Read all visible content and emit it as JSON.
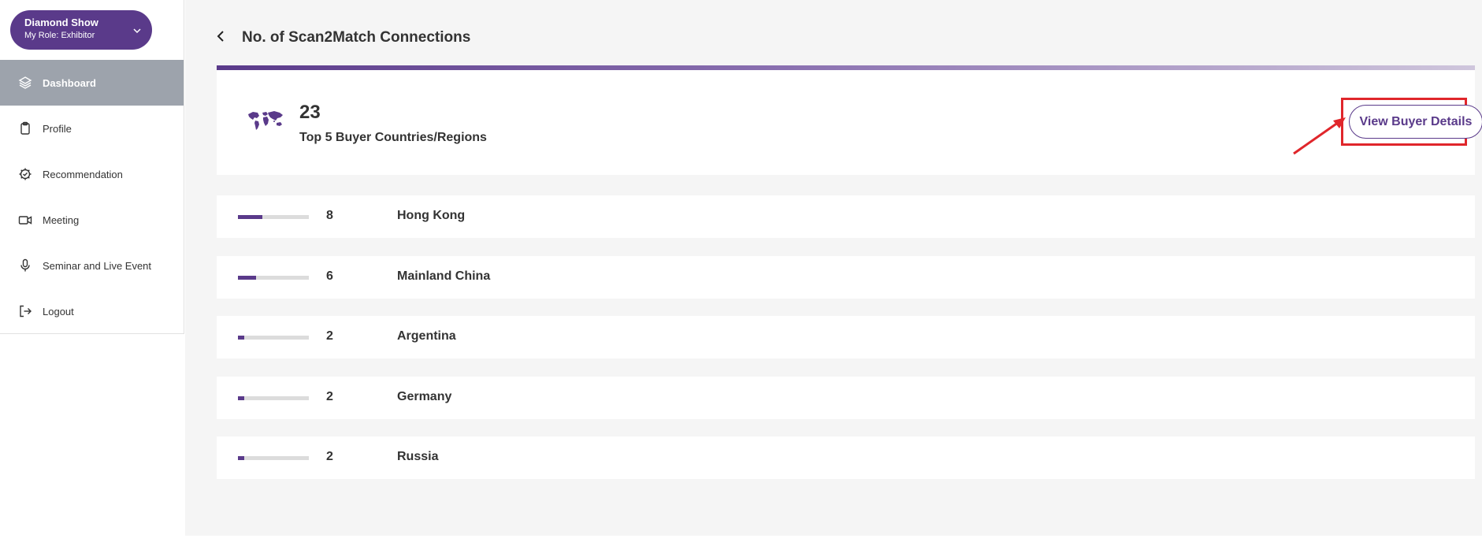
{
  "sidebar": {
    "event": {
      "name": "Diamond Show",
      "role": "My Role: Exhibitor"
    },
    "items": [
      {
        "label": "Dashboard",
        "icon": "layers-icon",
        "active": true
      },
      {
        "label": "Profile",
        "icon": "clipboard-icon",
        "active": false
      },
      {
        "label": "Recommendation",
        "icon": "badge-check-icon",
        "active": false
      },
      {
        "label": "Meeting",
        "icon": "video-camera-icon",
        "active": false
      },
      {
        "label": "Seminar and Live Event",
        "icon": "microphone-icon",
        "active": false
      },
      {
        "label": "Logout",
        "icon": "logout-icon",
        "active": false
      }
    ]
  },
  "main": {
    "title": "No. of Scan2Match Connections",
    "summary": {
      "total": "23",
      "label": "Top 5 Buyer Countries/Regions",
      "button_label": "View Buyer Details"
    },
    "rows": [
      {
        "count": "8",
        "country": "Hong Kong",
        "fraction": 0.348
      },
      {
        "count": "6",
        "country": "Mainland China",
        "fraction": 0.261
      },
      {
        "count": "2",
        "country": "Argentina",
        "fraction": 0.087
      },
      {
        "count": "2",
        "country": "Germany",
        "fraction": 0.087
      },
      {
        "count": "2",
        "country": "Russia",
        "fraction": 0.087
      }
    ]
  },
  "colors": {
    "brand_purple": "#5a3a8a",
    "active_nav_bg": "#9da3ac",
    "annotation_red": "#e0262b",
    "progress_track": "#dcdcdc",
    "page_bg": "#f5f5f5"
  }
}
